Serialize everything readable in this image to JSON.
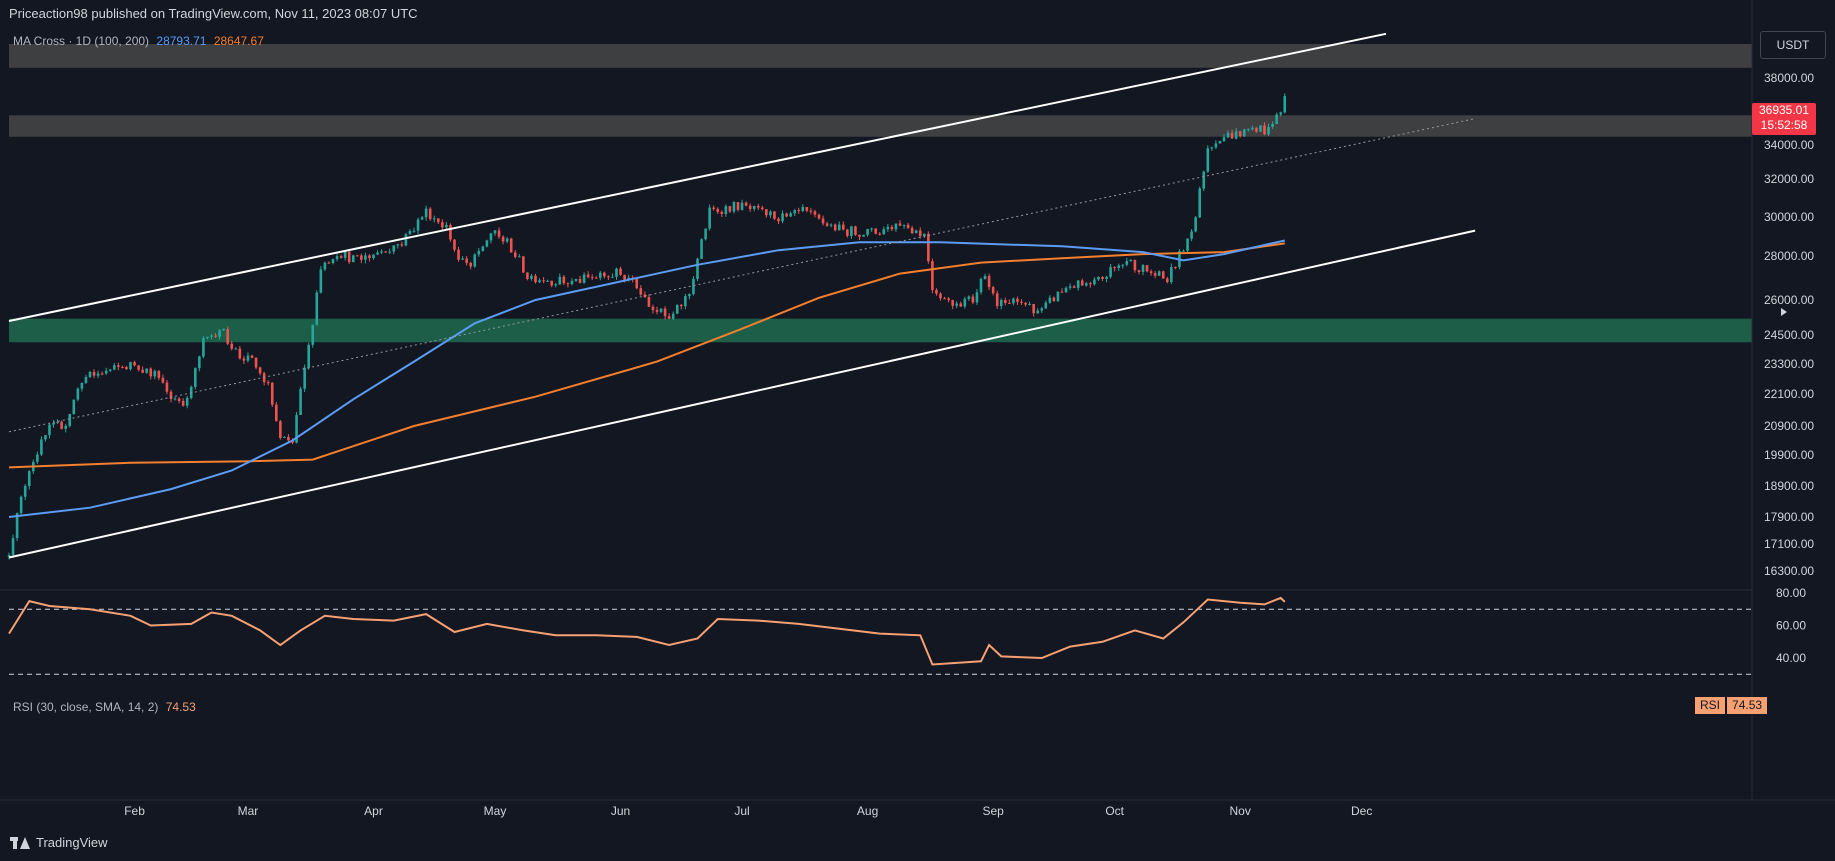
{
  "header": {
    "published": "Priceaction98 published on TradingView.com, Nov 11, 2023 08:07 UTC"
  },
  "indicator": {
    "label": "MA Cross · 1D (100, 200)",
    "ma100_value": "28793.71",
    "ma200_value": "28647.67"
  },
  "rsi_label": {
    "label": "RSI (30, close, SMA, 14, 2)",
    "value": "74.53"
  },
  "currency_button": "USDT",
  "last_price": {
    "price": "36935.01",
    "countdown": "15:52:58"
  },
  "rsi_badge": {
    "name": "RSI",
    "value": "74.53"
  },
  "footer": {
    "brand": "TradingView"
  },
  "colors": {
    "bg": "#131722",
    "up": "#26a69a",
    "down": "#ef5350",
    "ma100": "#5b9cf6",
    "ma200": "#f57f2d",
    "rsi": "#f7a072",
    "support_zone": "#1e6b4f",
    "resistance_zone": "#4a4a4a"
  },
  "chart_data": [
    {
      "type": "candlestick",
      "title": "",
      "y_ticks": [
        38000,
        36000,
        34000,
        32000,
        30000,
        28000,
        26000,
        24500,
        23300,
        22100,
        20900,
        19900,
        18900,
        17900,
        17100,
        16300
      ],
      "y_tick_labels": [
        "38000.00",
        "36000.00",
        "34000.00",
        "32000.00",
        "30000.00",
        "28000.00",
        "26000.00",
        "24500.00",
        "23300.00",
        "22100.00",
        "20900.00",
        "19900.00",
        "18900.00",
        "17900.00",
        "17100.00",
        "16300.00"
      ],
      "x_tick_labels": [
        "Feb",
        "Mar",
        "Apr",
        "May",
        "Jun",
        "Jul",
        "Aug",
        "Sep",
        "Oct",
        "Nov",
        "Dec"
      ],
      "x_tick_days": [
        31,
        59,
        90,
        120,
        151,
        181,
        212,
        243,
        273,
        304,
        334
      ],
      "ohlc_anchors": [
        {
          "day": 0,
          "close": 16900
        },
        {
          "day": 5,
          "close": 19500
        },
        {
          "day": 10,
          "close": 20800
        },
        {
          "day": 14,
          "close": 21000
        },
        {
          "day": 18,
          "close": 22700
        },
        {
          "day": 24,
          "close": 23000
        },
        {
          "day": 31,
          "close": 23300
        },
        {
          "day": 36,
          "close": 22900
        },
        {
          "day": 40,
          "close": 22000
        },
        {
          "day": 44,
          "close": 21800
        },
        {
          "day": 48,
          "close": 24200
        },
        {
          "day": 52,
          "close": 24800
        },
        {
          "day": 57,
          "close": 23600
        },
        {
          "day": 60,
          "close": 23400
        },
        {
          "day": 64,
          "close": 22400
        },
        {
          "day": 67,
          "close": 20400
        },
        {
          "day": 70,
          "close": 20300
        },
        {
          "day": 74,
          "close": 24000
        },
        {
          "day": 77,
          "close": 27500
        },
        {
          "day": 81,
          "close": 28200
        },
        {
          "day": 86,
          "close": 27800
        },
        {
          "day": 91,
          "close": 28200
        },
        {
          "day": 97,
          "close": 28700
        },
        {
          "day": 103,
          "close": 30300
        },
        {
          "day": 108,
          "close": 29500
        },
        {
          "day": 111,
          "close": 27800
        },
        {
          "day": 114,
          "close": 27500
        },
        {
          "day": 119,
          "close": 29200
        },
        {
          "day": 123,
          "close": 28700
        },
        {
          "day": 128,
          "close": 27100
        },
        {
          "day": 134,
          "close": 26900
        },
        {
          "day": 138,
          "close": 26800
        },
        {
          "day": 144,
          "close": 27000
        },
        {
          "day": 150,
          "close": 27200
        },
        {
          "day": 154,
          "close": 27000
        },
        {
          "day": 158,
          "close": 25900
        },
        {
          "day": 163,
          "close": 25100
        },
        {
          "day": 168,
          "close": 26300
        },
        {
          "day": 173,
          "close": 30300
        },
        {
          "day": 180,
          "close": 30600
        },
        {
          "day": 186,
          "close": 30200
        },
        {
          "day": 192,
          "close": 29900
        },
        {
          "day": 196,
          "close": 30300
        },
        {
          "day": 200,
          "close": 29800
        },
        {
          "day": 206,
          "close": 29300
        },
        {
          "day": 214,
          "close": 29200
        },
        {
          "day": 220,
          "close": 29700
        },
        {
          "day": 226,
          "close": 29100
        },
        {
          "day": 228,
          "close": 26600
        },
        {
          "day": 232,
          "close": 25900
        },
        {
          "day": 238,
          "close": 26000
        },
        {
          "day": 241,
          "close": 27300
        },
        {
          "day": 244,
          "close": 25800
        },
        {
          "day": 250,
          "close": 25900
        },
        {
          "day": 255,
          "close": 25500
        },
        {
          "day": 258,
          "close": 26100
        },
        {
          "day": 262,
          "close": 26700
        },
        {
          "day": 267,
          "close": 26600
        },
        {
          "day": 272,
          "close": 27300
        },
        {
          "day": 276,
          "close": 27800
        },
        {
          "day": 280,
          "close": 27400
        },
        {
          "day": 286,
          "close": 26900
        },
        {
          "day": 290,
          "close": 28400
        },
        {
          "day": 293,
          "close": 30000
        },
        {
          "day": 296,
          "close": 33900
        },
        {
          "day": 299,
          "close": 34500
        },
        {
          "day": 304,
          "close": 34700
        },
        {
          "day": 308,
          "close": 35100
        },
        {
          "day": 311,
          "close": 34800
        },
        {
          "day": 314,
          "close": 36200
        },
        {
          "day": 315,
          "close": 36935
        }
      ],
      "ma100": [
        {
          "day": 0,
          "value": 17900
        },
        {
          "day": 20,
          "value": 18200
        },
        {
          "day": 40,
          "value": 18800
        },
        {
          "day": 55,
          "value": 19400
        },
        {
          "day": 70,
          "value": 20400
        },
        {
          "day": 85,
          "value": 21900
        },
        {
          "day": 100,
          "value": 23400
        },
        {
          "day": 115,
          "value": 25000
        },
        {
          "day": 130,
          "value": 26000
        },
        {
          "day": 150,
          "value": 26800
        },
        {
          "day": 170,
          "value": 27600
        },
        {
          "day": 190,
          "value": 28300
        },
        {
          "day": 210,
          "value": 28700
        },
        {
          "day": 230,
          "value": 28700
        },
        {
          "day": 260,
          "value": 28500
        },
        {
          "day": 280,
          "value": 28200
        },
        {
          "day": 290,
          "value": 27800
        },
        {
          "day": 300,
          "value": 28100
        },
        {
          "day": 315,
          "value": 28793.71
        }
      ],
      "ma200": [
        {
          "day": 0,
          "value": 19500
        },
        {
          "day": 30,
          "value": 19650
        },
        {
          "day": 60,
          "value": 19700
        },
        {
          "day": 75,
          "value": 19750
        },
        {
          "day": 100,
          "value": 20900
        },
        {
          "day": 130,
          "value": 22000
        },
        {
          "day": 160,
          "value": 23400
        },
        {
          "day": 180,
          "value": 24700
        },
        {
          "day": 200,
          "value": 26100
        },
        {
          "day": 220,
          "value": 27200
        },
        {
          "day": 240,
          "value": 27700
        },
        {
          "day": 260,
          "value": 27900
        },
        {
          "day": 280,
          "value": 28100
        },
        {
          "day": 300,
          "value": 28200
        },
        {
          "day": 315,
          "value": 28647.67
        }
      ],
      "zones": [
        {
          "name": "resistance-zone-upper",
          "from": 38600,
          "to": 40000
        },
        {
          "name": "resistance-zone-lower",
          "from": 34500,
          "to": 35800
        },
        {
          "name": "support-zone",
          "from": 24200,
          "to": 25200
        }
      ],
      "trendlines": [
        {
          "name": "channel-upper",
          "from": {
            "day": 0,
            "value": 25100
          },
          "to": {
            "day": 340,
            "value": 40600
          }
        },
        {
          "name": "channel-lower",
          "from": {
            "day": 0,
            "value": 16700
          },
          "to": {
            "day": 362,
            "value": 29300
          }
        },
        {
          "name": "channel-mid",
          "style": "dotted",
          "from": {
            "day": 0,
            "value": 20700
          },
          "to": {
            "day": 362,
            "value": 35600
          }
        }
      ]
    },
    {
      "type": "line",
      "name": "RSI",
      "y_ticks": [
        80,
        60,
        40
      ],
      "y_tick_labels": [
        "80.00",
        "60.00",
        "40.00"
      ],
      "levels": [
        70,
        30
      ],
      "values": [
        {
          "day": 0,
          "value": 55
        },
        {
          "day": 5,
          "value": 75
        },
        {
          "day": 10,
          "value": 72
        },
        {
          "day": 20,
          "value": 70
        },
        {
          "day": 30,
          "value": 66
        },
        {
          "day": 35,
          "value": 60
        },
        {
          "day": 45,
          "value": 61
        },
        {
          "day": 50,
          "value": 68
        },
        {
          "day": 55,
          "value": 66
        },
        {
          "day": 62,
          "value": 57
        },
        {
          "day": 67,
          "value": 48
        },
        {
          "day": 72,
          "value": 57
        },
        {
          "day": 78,
          "value": 66
        },
        {
          "day": 85,
          "value": 64
        },
        {
          "day": 95,
          "value": 63
        },
        {
          "day": 103,
          "value": 67
        },
        {
          "day": 110,
          "value": 56
        },
        {
          "day": 118,
          "value": 61
        },
        {
          "day": 127,
          "value": 57
        },
        {
          "day": 135,
          "value": 54
        },
        {
          "day": 145,
          "value": 54
        },
        {
          "day": 155,
          "value": 53
        },
        {
          "day": 163,
          "value": 48
        },
        {
          "day": 170,
          "value": 52
        },
        {
          "day": 175,
          "value": 64
        },
        {
          "day": 185,
          "value": 63
        },
        {
          "day": 195,
          "value": 61
        },
        {
          "day": 205,
          "value": 58
        },
        {
          "day": 215,
          "value": 55
        },
        {
          "day": 225,
          "value": 54
        },
        {
          "day": 228,
          "value": 36
        },
        {
          "day": 240,
          "value": 38
        },
        {
          "day": 242,
          "value": 48
        },
        {
          "day": 245,
          "value": 41
        },
        {
          "day": 255,
          "value": 40
        },
        {
          "day": 262,
          "value": 47
        },
        {
          "day": 270,
          "value": 50
        },
        {
          "day": 278,
          "value": 57
        },
        {
          "day": 285,
          "value": 52
        },
        {
          "day": 290,
          "value": 62
        },
        {
          "day": 296,
          "value": 76
        },
        {
          "day": 304,
          "value": 74
        },
        {
          "day": 310,
          "value": 73
        },
        {
          "day": 314,
          "value": 77
        },
        {
          "day": 315,
          "value": 74.53
        }
      ]
    }
  ]
}
